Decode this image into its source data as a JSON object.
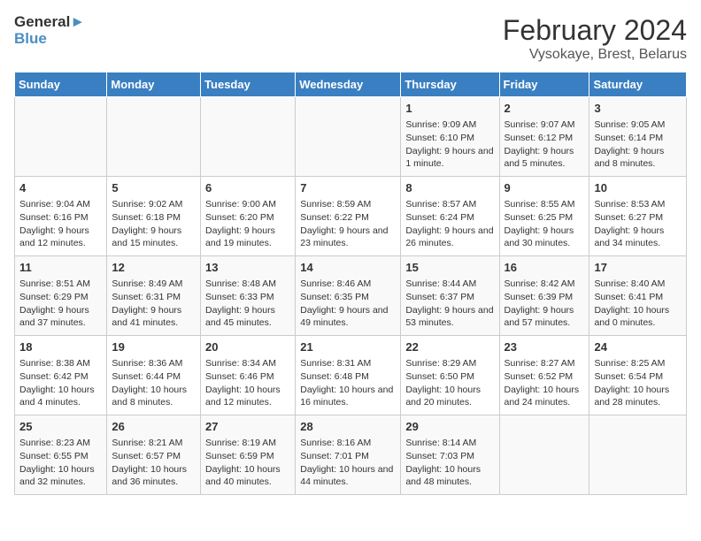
{
  "logo": {
    "line1": "General",
    "line2": "Blue"
  },
  "header": {
    "month": "February 2024",
    "subtitle": "Vysokaye, Brest, Belarus"
  },
  "days_of_week": [
    "Sunday",
    "Monday",
    "Tuesday",
    "Wednesday",
    "Thursday",
    "Friday",
    "Saturday"
  ],
  "weeks": [
    [
      {
        "day": "",
        "info": ""
      },
      {
        "day": "",
        "info": ""
      },
      {
        "day": "",
        "info": ""
      },
      {
        "day": "",
        "info": ""
      },
      {
        "day": "1",
        "info": "Sunrise: 9:09 AM\nSunset: 6:10 PM\nDaylight: 9 hours and 1 minute."
      },
      {
        "day": "2",
        "info": "Sunrise: 9:07 AM\nSunset: 6:12 PM\nDaylight: 9 hours and 5 minutes."
      },
      {
        "day": "3",
        "info": "Sunrise: 9:05 AM\nSunset: 6:14 PM\nDaylight: 9 hours and 8 minutes."
      }
    ],
    [
      {
        "day": "4",
        "info": "Sunrise: 9:04 AM\nSunset: 6:16 PM\nDaylight: 9 hours and 12 minutes."
      },
      {
        "day": "5",
        "info": "Sunrise: 9:02 AM\nSunset: 6:18 PM\nDaylight: 9 hours and 15 minutes."
      },
      {
        "day": "6",
        "info": "Sunrise: 9:00 AM\nSunset: 6:20 PM\nDaylight: 9 hours and 19 minutes."
      },
      {
        "day": "7",
        "info": "Sunrise: 8:59 AM\nSunset: 6:22 PM\nDaylight: 9 hours and 23 minutes."
      },
      {
        "day": "8",
        "info": "Sunrise: 8:57 AM\nSunset: 6:24 PM\nDaylight: 9 hours and 26 minutes."
      },
      {
        "day": "9",
        "info": "Sunrise: 8:55 AM\nSunset: 6:25 PM\nDaylight: 9 hours and 30 minutes."
      },
      {
        "day": "10",
        "info": "Sunrise: 8:53 AM\nSunset: 6:27 PM\nDaylight: 9 hours and 34 minutes."
      }
    ],
    [
      {
        "day": "11",
        "info": "Sunrise: 8:51 AM\nSunset: 6:29 PM\nDaylight: 9 hours and 37 minutes."
      },
      {
        "day": "12",
        "info": "Sunrise: 8:49 AM\nSunset: 6:31 PM\nDaylight: 9 hours and 41 minutes."
      },
      {
        "day": "13",
        "info": "Sunrise: 8:48 AM\nSunset: 6:33 PM\nDaylight: 9 hours and 45 minutes."
      },
      {
        "day": "14",
        "info": "Sunrise: 8:46 AM\nSunset: 6:35 PM\nDaylight: 9 hours and 49 minutes."
      },
      {
        "day": "15",
        "info": "Sunrise: 8:44 AM\nSunset: 6:37 PM\nDaylight: 9 hours and 53 minutes."
      },
      {
        "day": "16",
        "info": "Sunrise: 8:42 AM\nSunset: 6:39 PM\nDaylight: 9 hours and 57 minutes."
      },
      {
        "day": "17",
        "info": "Sunrise: 8:40 AM\nSunset: 6:41 PM\nDaylight: 10 hours and 0 minutes."
      }
    ],
    [
      {
        "day": "18",
        "info": "Sunrise: 8:38 AM\nSunset: 6:42 PM\nDaylight: 10 hours and 4 minutes."
      },
      {
        "day": "19",
        "info": "Sunrise: 8:36 AM\nSunset: 6:44 PM\nDaylight: 10 hours and 8 minutes."
      },
      {
        "day": "20",
        "info": "Sunrise: 8:34 AM\nSunset: 6:46 PM\nDaylight: 10 hours and 12 minutes."
      },
      {
        "day": "21",
        "info": "Sunrise: 8:31 AM\nSunset: 6:48 PM\nDaylight: 10 hours and 16 minutes."
      },
      {
        "day": "22",
        "info": "Sunrise: 8:29 AM\nSunset: 6:50 PM\nDaylight: 10 hours and 20 minutes."
      },
      {
        "day": "23",
        "info": "Sunrise: 8:27 AM\nSunset: 6:52 PM\nDaylight: 10 hours and 24 minutes."
      },
      {
        "day": "24",
        "info": "Sunrise: 8:25 AM\nSunset: 6:54 PM\nDaylight: 10 hours and 28 minutes."
      }
    ],
    [
      {
        "day": "25",
        "info": "Sunrise: 8:23 AM\nSunset: 6:55 PM\nDaylight: 10 hours and 32 minutes."
      },
      {
        "day": "26",
        "info": "Sunrise: 8:21 AM\nSunset: 6:57 PM\nDaylight: 10 hours and 36 minutes."
      },
      {
        "day": "27",
        "info": "Sunrise: 8:19 AM\nSunset: 6:59 PM\nDaylight: 10 hours and 40 minutes."
      },
      {
        "day": "28",
        "info": "Sunrise: 8:16 AM\nSunset: 7:01 PM\nDaylight: 10 hours and 44 minutes."
      },
      {
        "day": "29",
        "info": "Sunrise: 8:14 AM\nSunset: 7:03 PM\nDaylight: 10 hours and 48 minutes."
      },
      {
        "day": "",
        "info": ""
      },
      {
        "day": "",
        "info": ""
      }
    ]
  ]
}
